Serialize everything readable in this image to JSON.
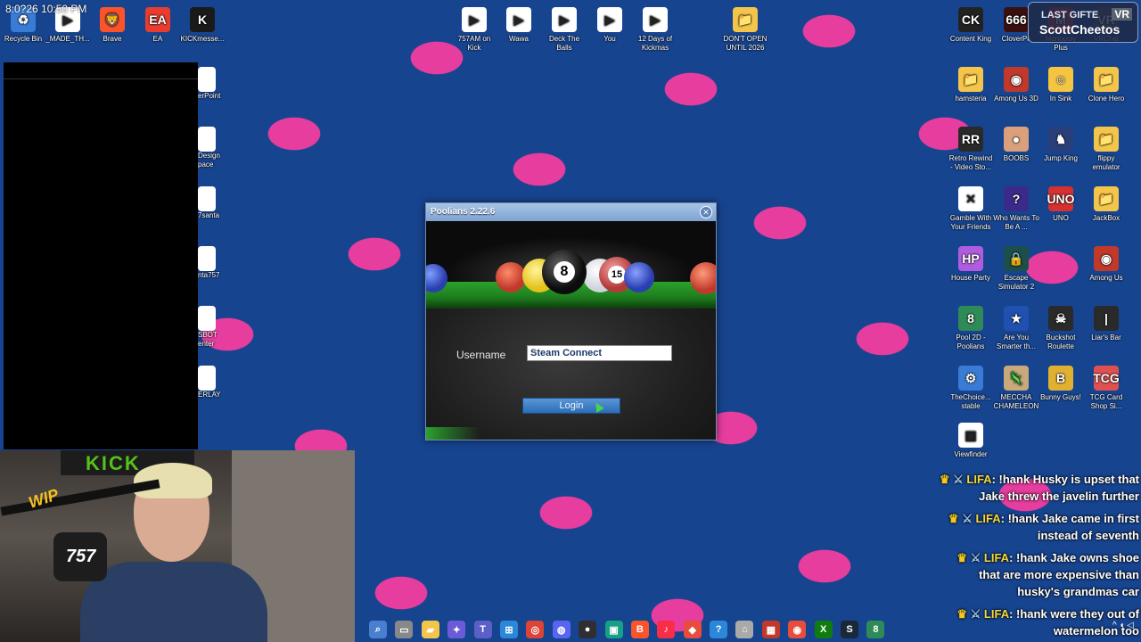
{
  "overlay": {
    "clock": "8:0?26 10:50 PM"
  },
  "desktop_left_icons": [
    {
      "label": "Recycle Bin",
      "glyph": "♻",
      "color": "#3a7bd5"
    },
    {
      "label": "_MADE_TH...",
      "glyph": "▶",
      "color": "#ffffff"
    },
    {
      "label": "Brave",
      "glyph": "🦁",
      "color": "#fb542b"
    },
    {
      "label": "EA",
      "glyph": "EA",
      "color": "#e83c2e"
    },
    {
      "label": "KICKmesse...",
      "glyph": "K",
      "color": "#1a1a1a"
    }
  ],
  "desktop_partial_icons": [
    {
      "label": "erPoint"
    },
    {
      "label": "Design pace"
    },
    {
      "label": "7santa"
    },
    {
      "label": "nta757"
    },
    {
      "label": "SBOT enter"
    },
    {
      "label": "ERLAY"
    }
  ],
  "desktop_center_icons": [
    {
      "label": "757AM on Kick",
      "glyph": "▶"
    },
    {
      "label": "Wawa",
      "glyph": "▶"
    },
    {
      "label": "Deck The Balls",
      "glyph": "▶"
    },
    {
      "label": "You",
      "glyph": "▶"
    },
    {
      "label": "12 Days of Kickmas",
      "glyph": "▶"
    },
    {
      "label": "DON'T OPEN UNTIL 2026",
      "glyph": "📁"
    }
  ],
  "desktop_right_icons": [
    {
      "label": "Content King",
      "glyph": "CK",
      "color": "#222222"
    },
    {
      "label": "CloverPit",
      "glyph": "666",
      "color": "#3a0f0f"
    },
    {
      "label": "Monopoly Plus",
      "glyph": "M",
      "color": "#c0392b"
    },
    {
      "label": "VRChat",
      "glyph": "VR",
      "color": "#555555"
    },
    {
      "label": "hamsteria",
      "glyph": "📁",
      "color": "#f3c54b"
    },
    {
      "label": "Among Us 3D",
      "glyph": "◉",
      "color": "#c0392b"
    },
    {
      "label": "In Sink",
      "glyph": "☺",
      "color": "#f5c542"
    },
    {
      "label": "Clone Hero",
      "glyph": "📁",
      "color": "#f3c54b"
    },
    {
      "label": "Retro Rewind - Video Sto...",
      "glyph": "RR",
      "color": "#2a2a2a"
    },
    {
      "label": "BOOBS",
      "glyph": "●",
      "color": "#d9a07b"
    },
    {
      "label": "Jump King",
      "glyph": "♞",
      "color": "#2a3f7a"
    },
    {
      "label": "flippy emulator",
      "glyph": "📁",
      "color": "#f3c54b"
    },
    {
      "label": "Gamble With Your Friends",
      "glyph": "✕",
      "color": "#ffffff"
    },
    {
      "label": "Who Wants To Be A ...",
      "glyph": "?",
      "color": "#3b2a8a"
    },
    {
      "label": "UNO",
      "glyph": "UNO",
      "color": "#d63031"
    },
    {
      "label": "JackBox",
      "glyph": "📁",
      "color": "#f3c54b"
    },
    {
      "label": "House Party",
      "glyph": "HP",
      "color": "#b05ce0"
    },
    {
      "label": "Escape Simulator 2",
      "glyph": "🔒",
      "color": "#1d4f4a"
    },
    {
      "label": "",
      "glyph": "",
      "color": "transparent"
    },
    {
      "label": "Among Us",
      "glyph": "◉",
      "color": "#c0392b"
    },
    {
      "label": "Pool 2D - Poolians",
      "glyph": "8",
      "color": "#2e8b57"
    },
    {
      "label": "Are You Smarter th...",
      "glyph": "★",
      "color": "#2050b0"
    },
    {
      "label": "Buckshot Roulette",
      "glyph": "☠",
      "color": "#2a2a2a"
    },
    {
      "label": "Liar's Bar",
      "glyph": "|",
      "color": "#2a2a2a"
    },
    {
      "label": "TheChoice... stable",
      "glyph": "⚙",
      "color": "#3a7bd5"
    },
    {
      "label": "MECCHA CHAMELEON",
      "glyph": "🦎",
      "color": "#c9a87a"
    },
    {
      "label": "Bunny Guys!",
      "glyph": "B",
      "color": "#e0b030"
    },
    {
      "label": "TCG Card Shop Si...",
      "glyph": "TCG",
      "color": "#e05050"
    },
    {
      "label": "Viewfinder",
      "glyph": "▣",
      "color": "#ffffff"
    }
  ],
  "notification": {
    "small": "LAST GIFTE",
    "big": "ScottCheetos",
    "badge": "VR"
  },
  "webcam": {
    "sign": "KICK",
    "mic_logo": "757",
    "brand": "WIP"
  },
  "chat": [
    {
      "user": "LIFA",
      "text": ": !hank Husky is upset that Jake threw the javelin further"
    },
    {
      "user": "LIFA",
      "text": ": !hank Jake came in first instead of seventh"
    },
    {
      "user": "LIFA",
      "text": ": !hank Jake owns shoe that are more expensive than husky's grandmas car"
    },
    {
      "user": "LIFA",
      "text": ": !hank were they out of watermelon too"
    }
  ],
  "taskbar_icons": [
    {
      "name": "search",
      "glyph": "⌕",
      "color": "#4a7fd0"
    },
    {
      "name": "task-view",
      "glyph": "▭",
      "color": "#888888"
    },
    {
      "name": "file-explorer",
      "glyph": "▰",
      "color": "#f3c54b"
    },
    {
      "name": "copilot",
      "glyph": "✦",
      "color": "#6b5bd8"
    },
    {
      "name": "teams",
      "glyph": "T",
      "color": "#5b5fc7"
    },
    {
      "name": "store",
      "glyph": "⊞",
      "color": "#2b88d8"
    },
    {
      "name": "chrome",
      "glyph": "◎",
      "color": "#db4437"
    },
    {
      "name": "discord",
      "glyph": "◍",
      "color": "#5865f2"
    },
    {
      "name": "obs",
      "glyph": "●",
      "color": "#302e31"
    },
    {
      "name": "app",
      "glyph": "▣",
      "color": "#16a085"
    },
    {
      "name": "brave",
      "glyph": "B",
      "color": "#fb542b"
    },
    {
      "name": "music",
      "glyph": "♪",
      "color": "#fa2d48"
    },
    {
      "name": "app2",
      "glyph": "◆",
      "color": "#e74c3c"
    },
    {
      "name": "help",
      "glyph": "?",
      "color": "#2b88d8"
    },
    {
      "name": "app3",
      "glyph": "⌂",
      "color": "#aaaaaa"
    },
    {
      "name": "app4",
      "glyph": "▦",
      "color": "#c0392b"
    },
    {
      "name": "app5",
      "glyph": "◉",
      "color": "#e74c3c"
    },
    {
      "name": "xbox",
      "glyph": "X",
      "color": "#107c10"
    },
    {
      "name": "steam",
      "glyph": "S",
      "color": "#1b2838"
    },
    {
      "name": "pool",
      "glyph": "8",
      "color": "#2e8b57"
    }
  ],
  "tray": {
    "text": "^  ◖ ◁"
  },
  "dialog": {
    "title": "Poolians 2.22.6",
    "username_label": "Username",
    "username_value": "Steam Connect",
    "login_label": "Login",
    "balls": [
      "8",
      "15"
    ]
  }
}
